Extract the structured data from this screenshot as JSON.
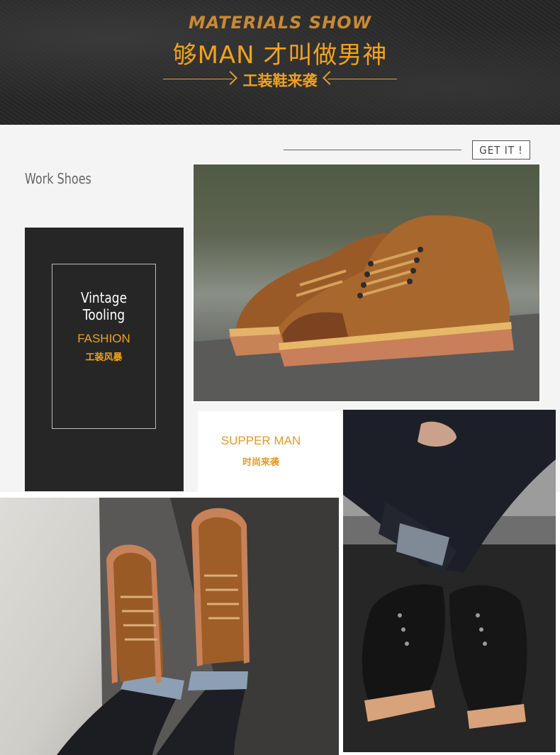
{
  "banner": {
    "title": "MATERIALS SHOW",
    "headline": "够MAN 才叫做男神",
    "subtitle": "工装鞋来袭"
  },
  "cta": {
    "label": "GET IT !"
  },
  "section": {
    "label": "Work Shoes"
  },
  "card_dark": {
    "title": "Vintage Tooling",
    "tag": "FASHION",
    "tag_cn": "工装风暴"
  },
  "card_white": {
    "title": "SUPPER MAN",
    "title_cn": "时尚来袭"
  },
  "colors": {
    "accent": "#f0a21c",
    "banner_bg": "#262626",
    "card_bg": "#262626",
    "page_bg": "#f4f4f4"
  }
}
